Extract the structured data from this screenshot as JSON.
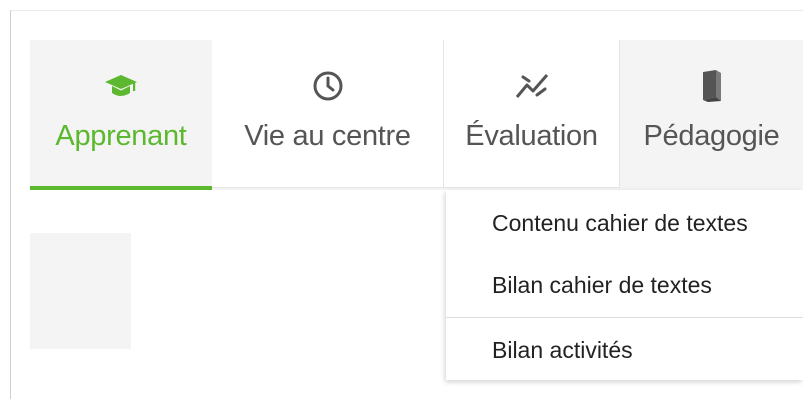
{
  "nav": {
    "tabs": [
      {
        "label": "Apprenant",
        "icon": "graduation-cap-icon",
        "active": true
      },
      {
        "label": "Vie au centre",
        "icon": "clock-icon",
        "active": false
      },
      {
        "label": "Évaluation",
        "icon": "chart-line-icon",
        "active": false
      },
      {
        "label": "Pédagogie",
        "icon": "book-icon",
        "active": false
      }
    ]
  },
  "dropdown": {
    "items": [
      {
        "label": "Contenu cahier de textes"
      },
      {
        "label": "Bilan cahier de textes"
      },
      {
        "label": "Bilan activités"
      }
    ]
  },
  "colors": {
    "accent": "#5cb82e",
    "text": "#555555",
    "nav_background": "#f4f4f4"
  }
}
